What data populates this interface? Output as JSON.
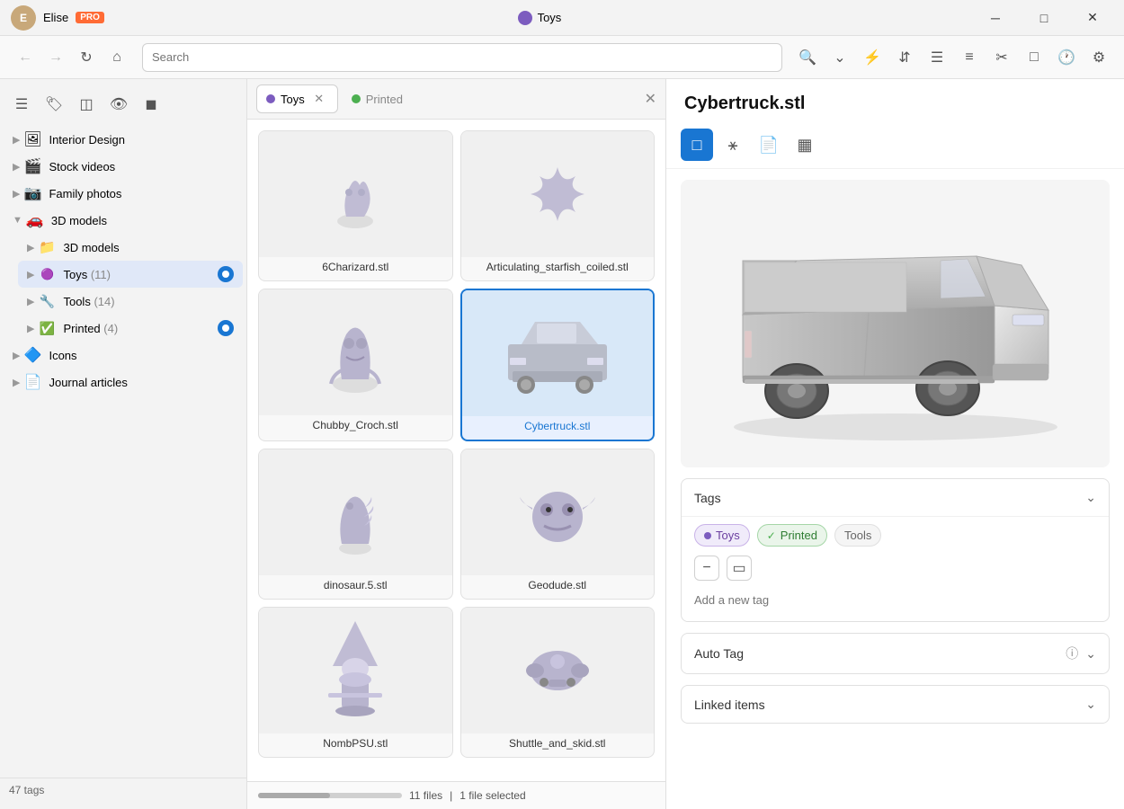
{
  "titlebar": {
    "user": "Elise",
    "pro_label": "PRO",
    "title": "Toys",
    "min_btn": "─",
    "max_btn": "□",
    "close_btn": "✕"
  },
  "toolbar": {
    "back_btn": "←",
    "forward_btn": "→",
    "refresh_btn": "↻",
    "home_btn": "⌂",
    "search_placeholder": "Search",
    "icons": [
      "🔍",
      "∨",
      "⚡",
      "↕",
      "☰",
      "⋮⋮",
      "✂",
      "⬜",
      "🕐",
      "⚙"
    ]
  },
  "sidebar": {
    "toolbar_icons": [
      "☰",
      "🏷",
      "▭▭",
      "👁",
      "◼"
    ],
    "items": [
      {
        "label": "Interior Design",
        "icon": "🖼",
        "count": ""
      },
      {
        "label": "Stock videos",
        "icon": "🎬",
        "count": ""
      },
      {
        "label": "Family photos",
        "icon": "📷",
        "count": ""
      },
      {
        "label": "3D models",
        "icon": "🚗",
        "count": "",
        "expanded": true
      },
      {
        "label": "3D models",
        "icon": "📁",
        "count": "",
        "indent": 1
      },
      {
        "label": "Toys",
        "icon": "🟣",
        "count": "(11)",
        "indent": 1,
        "active": true,
        "badge": true
      },
      {
        "label": "Tools",
        "icon": "🔧",
        "count": "(14)",
        "indent": 1
      },
      {
        "label": "Printed",
        "icon": "✅",
        "count": "(4)",
        "indent": 1,
        "badge": true
      },
      {
        "label": "Icons",
        "icon": "🔷",
        "count": ""
      },
      {
        "label": "Journal articles",
        "icon": "📄",
        "count": ""
      }
    ],
    "footer": "47 tags"
  },
  "tabs": [
    {
      "label": "Toys",
      "icon_color": "purple",
      "active": true
    },
    {
      "label": "Printed",
      "icon_color": "green",
      "active": false
    }
  ],
  "files": [
    {
      "name": "6Charizard.stl",
      "selected": false
    },
    {
      "name": "Articulating_starfish_coiled.stl",
      "selected": false
    },
    {
      "name": "Chubby_Croch.stl",
      "selected": false
    },
    {
      "name": "Cybertruck.stl",
      "selected": true
    },
    {
      "name": "dinosaur.5.stl",
      "selected": false
    },
    {
      "name": "Geodude.stl",
      "selected": false
    },
    {
      "name": "NombPSU.stl",
      "selected": false
    },
    {
      "name": "Shuttle_and_skid.stl",
      "selected": false
    }
  ],
  "grid_footer": {
    "file_count": "11 files",
    "separator": "|",
    "selection": "1 file selected"
  },
  "detail": {
    "title": "Cybertruck.stl",
    "toolbar_btns": [
      "⬜",
      "☆",
      "📄",
      "▦"
    ],
    "tags_section": {
      "label": "Tags",
      "tags": [
        {
          "label": "Toys",
          "style": "purple"
        },
        {
          "label": "Printed",
          "style": "green"
        },
        {
          "label": "Tools",
          "style": "gray"
        }
      ],
      "add_placeholder": "Add a new tag"
    },
    "autotag_section": {
      "label": "Auto Tag",
      "collapsed": true
    },
    "linked_section": {
      "label": "Linked items",
      "collapsed": true
    }
  }
}
